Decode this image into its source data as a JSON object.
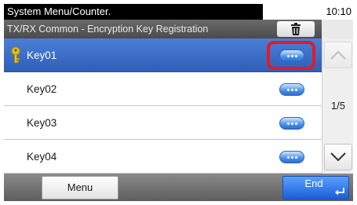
{
  "status": {
    "title": "System Menu/Counter.",
    "time": "10:10"
  },
  "header": {
    "title": "TX/RX Common - Encryption Key Registration",
    "trash_icon": "trash-icon"
  },
  "list": {
    "rows": [
      {
        "label": "Key01",
        "selected": true,
        "icon": "key-icon"
      },
      {
        "label": "Key02",
        "selected": false
      },
      {
        "label": "Key03",
        "selected": false
      },
      {
        "label": "Key04",
        "selected": false
      }
    ],
    "detail_icon": "ellipsis-icon"
  },
  "pagination": {
    "indicator": "1/5",
    "up_icon": "chevron-up-icon",
    "down_icon": "chevron-down-icon"
  },
  "footer": {
    "menu_label": "Menu",
    "end_label": "End",
    "enter_icon": "enter-icon"
  },
  "colors": {
    "selection": "#2f5fb8",
    "highlight": "#e01b24",
    "accent": "#1a5fd8",
    "key": "#f2c200"
  }
}
